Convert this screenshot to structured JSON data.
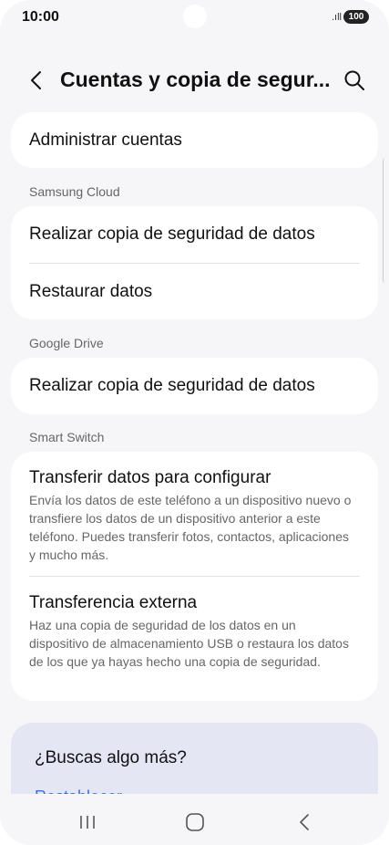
{
  "status": {
    "time": "10:00",
    "signal": ".ıll",
    "battery": "100"
  },
  "header": {
    "title": "Cuentas y copia de segur..."
  },
  "cards": {
    "manage_accounts": "Administrar cuentas",
    "samsung_cloud": {
      "section": "Samsung Cloud",
      "backup": "Realizar copia de seguridad de datos",
      "restore": "Restaurar datos"
    },
    "google_drive": {
      "section": "Google Drive",
      "backup": "Realizar copia de seguridad de datos"
    },
    "smart_switch": {
      "section": "Smart Switch",
      "transfer_title": "Transferir datos para configurar",
      "transfer_desc": "Envía los datos de este teléfono a un dispositivo nuevo o transfiere los datos de un dispositivo anterior a este teléfono. Puedes transferir fotos, contactos, aplicaciones y mucho más.",
      "external_title": "Transferencia externa",
      "external_desc": "Haz una copia de seguridad de los datos en un dispositivo de almacenamiento USB o restaura los datos de los que ya hayas hecho una copia de seguridad."
    }
  },
  "more": {
    "title": "¿Buscas algo más?",
    "link": "Restablecer"
  },
  "icons": {
    "back": "chevron-left-icon",
    "search": "search-icon",
    "nav_recents": "recents-icon",
    "nav_home": "home-icon",
    "nav_back": "back-icon"
  },
  "colors": {
    "background": "#f6f6f8",
    "card": "#ffffff",
    "more_card": "#e4e6f4",
    "link": "#3b6fd8"
  }
}
